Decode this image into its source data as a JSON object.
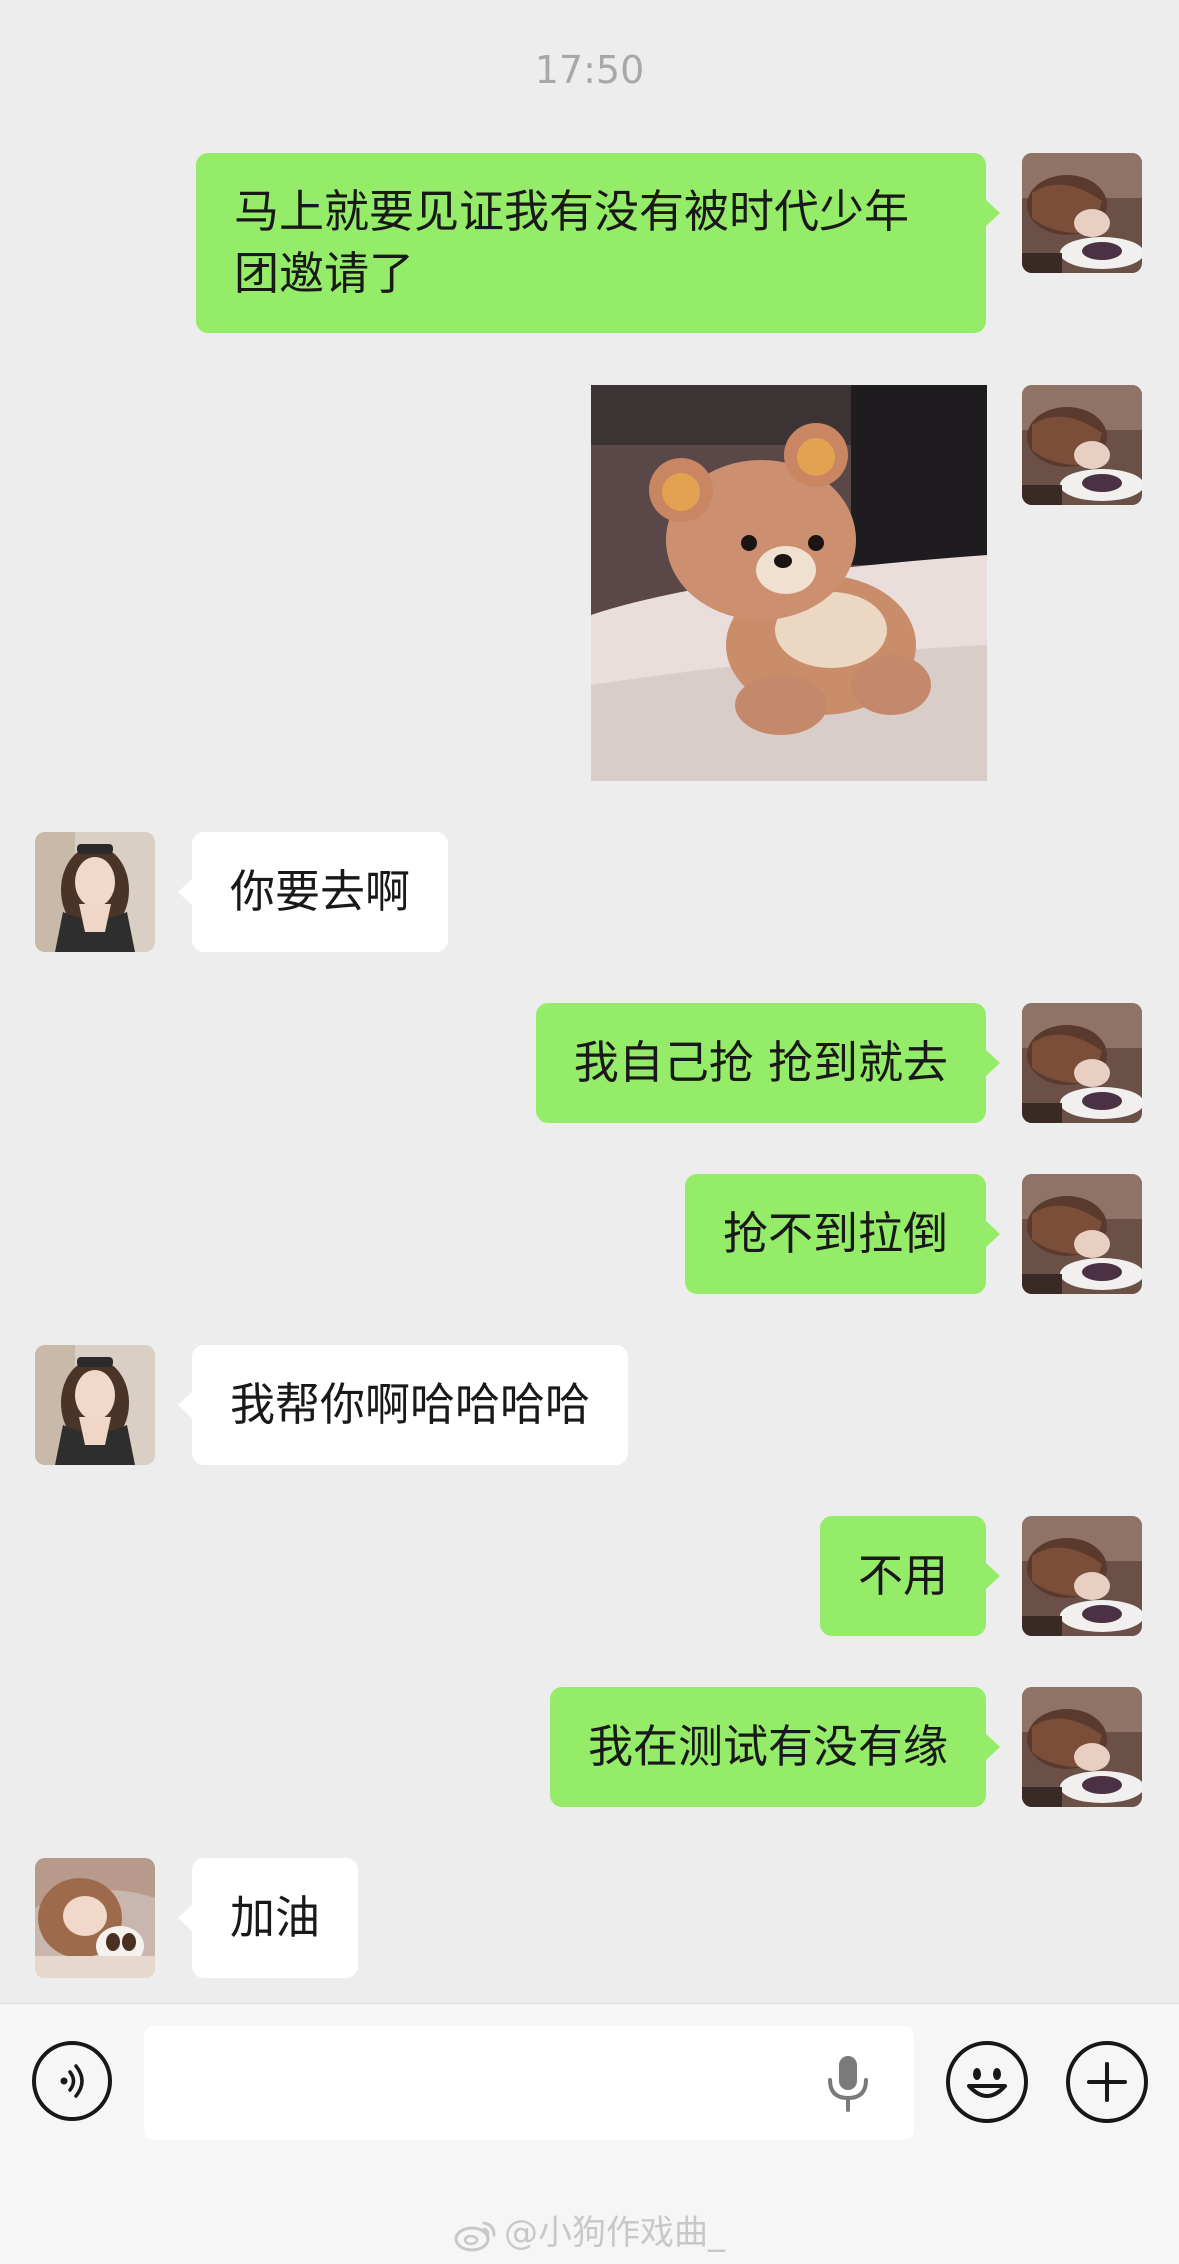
{
  "chat": {
    "timestamp": "17:50",
    "messages": [
      {
        "sender": "me",
        "type": "text",
        "text": "马上就要见证我有没有被时代少年团邀请了"
      },
      {
        "sender": "me",
        "type": "image",
        "description": "sticker"
      },
      {
        "sender": "peer",
        "type": "text",
        "text": "你要去啊"
      },
      {
        "sender": "me",
        "type": "text",
        "text": "我自己抢 抢到就去"
      },
      {
        "sender": "me",
        "type": "text",
        "text": "抢不到拉倒"
      },
      {
        "sender": "peer",
        "type": "text",
        "text": "我帮你啊哈哈哈哈"
      },
      {
        "sender": "me",
        "type": "text",
        "text": "不用"
      },
      {
        "sender": "me",
        "type": "text",
        "text": "我在测试有没有缘"
      },
      {
        "sender": "peer",
        "type": "text",
        "text": "加油"
      }
    ]
  },
  "input_bar": {
    "voice_icon": "voice-icon",
    "text_value": "",
    "mic_icon": "microphone-icon",
    "emoji_icon": "emoji-icon",
    "more_icon": "plus-icon"
  },
  "watermark": "@小狗作戏曲_",
  "colors": {
    "background": "#ededed",
    "my_bubble": "#95ec69",
    "peer_bubble": "#ffffff",
    "timestamp": "#a8a8a8"
  }
}
